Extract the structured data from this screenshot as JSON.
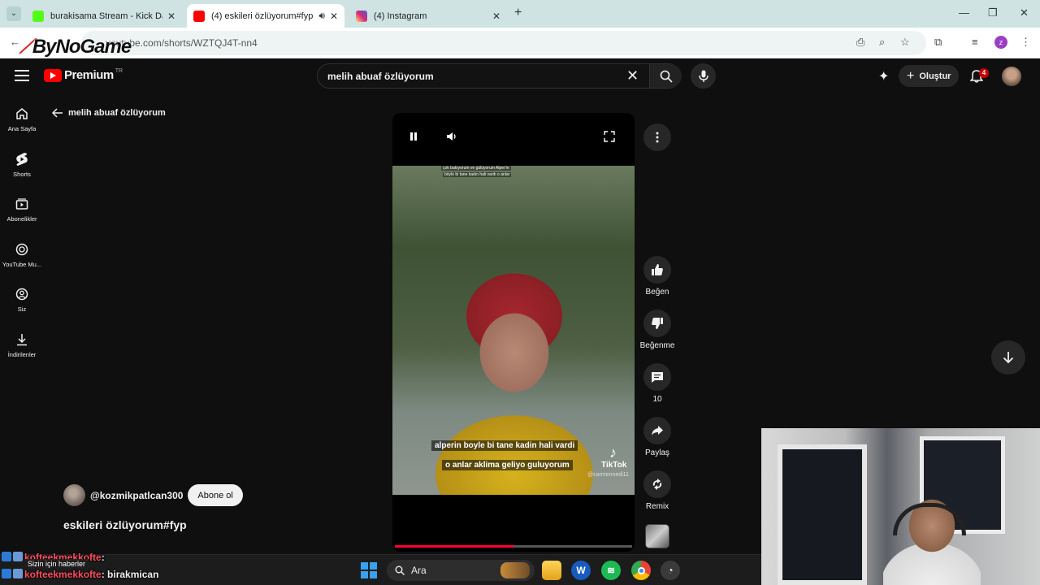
{
  "browser": {
    "tabs": [
      {
        "title": "burakisama Stream - Kick Dash",
        "favicon_color": "#53fc18",
        "active": false
      },
      {
        "title": "(4) eskileri özlüyorum#fyp",
        "favicon_color": "#ff0000",
        "active": true
      },
      {
        "title": "(4) Instagram",
        "favicon_color": "#d62976",
        "active": false
      }
    ],
    "url": "youtube.com/shorts/WZTQJ4T-nn4",
    "profile_initial": "z"
  },
  "overlay_logo": {
    "text": "ByNoGame"
  },
  "youtube": {
    "brand": "Premium",
    "country": "TR",
    "search_query": "melih abuaf özlüyorum",
    "create_label": "Oluştur",
    "notification_count": "4"
  },
  "sidebar": {
    "items": [
      {
        "label": "Ana Sayfa",
        "icon": "home-icon"
      },
      {
        "label": "Shorts",
        "icon": "shorts-icon"
      },
      {
        "label": "Abonelikler",
        "icon": "subscriptions-icon"
      },
      {
        "label": "YouTube Mu...",
        "icon": "youtube-music-icon"
      },
      {
        "label": "Siz",
        "icon": "account-icon"
      },
      {
        "label": "İndirilenler",
        "icon": "download-icon"
      }
    ]
  },
  "shorts": {
    "back_query": "melih abuaf özlüyorum",
    "video_top_caption_1": "çok bakıyorum ve gülüyorum Alper'in",
    "video_top_caption_2": "böyle bi tane kadın hali vardı o anlar",
    "caption_line_1": "alperin boyle bi tane kadin hali vardi",
    "caption_line_2": "o anlar aklima geliyo guluyorum",
    "tiktok_label": "TikTok",
    "tiktok_user": "@carmennedi11",
    "progress": 0.5,
    "actions": [
      {
        "label": "Beğen",
        "icon": "thumbs-up-icon"
      },
      {
        "label": "Beğenme",
        "icon": "thumbs-down-icon"
      },
      {
        "label": "10",
        "icon": "comment-icon"
      },
      {
        "label": "Paylaş",
        "icon": "share-icon"
      },
      {
        "label": "Remix",
        "icon": "remix-icon"
      }
    ],
    "channel_name": "@kozmikpatlcan300",
    "subscribe_label": "Abone ol",
    "title": "eskileri özlüyorum#fyp"
  },
  "taskbar": {
    "search_label": "Ara",
    "apps": [
      "file-explorer-icon",
      "word-icon",
      "spotify-icon",
      "chrome-icon",
      "app-icon"
    ]
  },
  "chat": {
    "toast": "Sizin için haberler",
    "messages": [
      {
        "user": "kofteekmekkofte",
        "text": ": "
      },
      {
        "user": "kofteekmekkofte",
        "text": ": birakmican"
      }
    ]
  },
  "colors": {
    "youtube_red": "#ff0000",
    "background": "#0f0f0f",
    "chat_user": "#ff4d5e",
    "tab_strip": "#cfe3e3"
  }
}
